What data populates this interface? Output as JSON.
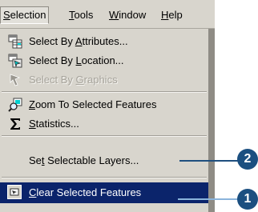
{
  "menubar": {
    "items": [
      {
        "label_pre": "",
        "label_ul": "S",
        "label_post": "election",
        "active": true
      },
      {
        "label_pre": "",
        "label_ul": "T",
        "label_post": "ools",
        "active": false
      },
      {
        "label_pre": "",
        "label_ul": "W",
        "label_post": "indow",
        "active": false
      },
      {
        "label_pre": "",
        "label_ul": "H",
        "label_post": "elp",
        "active": false
      }
    ]
  },
  "menu": {
    "items": [
      {
        "pre": "Select By ",
        "ul": "A",
        "post": "ttributes...",
        "icon": "attributes-table-icon",
        "enabled": true
      },
      {
        "pre": "Select By ",
        "ul": "L",
        "post": "ocation...",
        "icon": "select-location-icon",
        "enabled": true
      },
      {
        "pre": "Select By ",
        "ul": "G",
        "post": "raphics",
        "icon": "select-graphics-icon",
        "enabled": false
      },
      {
        "pre": "",
        "ul": "Z",
        "post": "oom To Selected Features",
        "icon": "zoom-selected-icon",
        "enabled": true
      },
      {
        "pre": "",
        "ul": "S",
        "post": "tatistics...",
        "icon": "sigma-icon",
        "enabled": true
      },
      {
        "pre": "Se",
        "ul": "t",
        "post": " Selectable Layers...",
        "icon": "",
        "enabled": true
      },
      {
        "pre": "",
        "ul": "C",
        "post": "lear Selected Features",
        "icon": "clear-selection-icon",
        "enabled": true,
        "highlighted": true
      }
    ]
  },
  "callouts": [
    {
      "label": "2"
    },
    {
      "label": "1"
    }
  ],
  "colors": {
    "menu_bg": "#d8d5cd",
    "highlight": "#0b246b",
    "callout": "#1b4f80"
  }
}
